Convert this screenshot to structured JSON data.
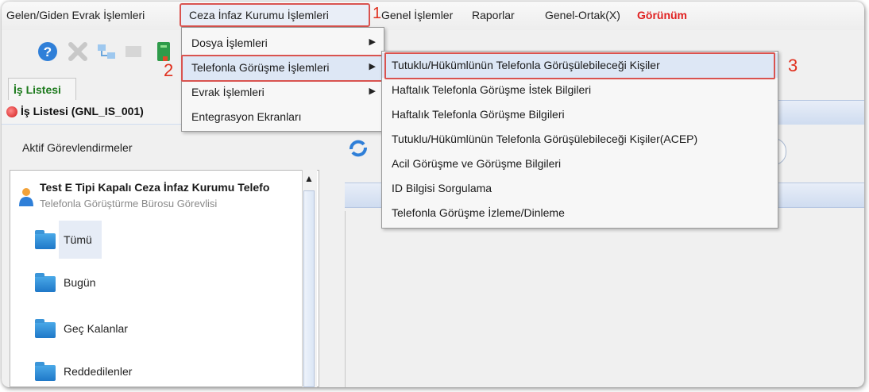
{
  "menubar": {
    "items": [
      "Gelen/Giden Evrak İşlemleri",
      "Ceza İnfaz Kurumu İşlemleri",
      "Genel İşlemler",
      "Raporlar",
      "Genel-Ortak(X)",
      "Görünüm"
    ],
    "step1": "1",
    "active_color": "#e02020"
  },
  "annotations": {
    "step2": "2",
    "step3": "3",
    "color": "#d9534f"
  },
  "toolbar": {
    "icons": [
      "help-icon",
      "delete-icon",
      "network-icon",
      "screen-icon",
      "book-icon"
    ]
  },
  "tabs": {
    "is_listesi": "İş Listesi"
  },
  "strip": {
    "title": "İş Listesi (GNL_IS_001)"
  },
  "left": {
    "heading": "Aktif Görevlendirmeler",
    "tree_title": "Test E Tipi Kapalı Ceza İnfaz Kurumu Telefo",
    "tree_subtitle": "Telefonla Görüştürme Bürosu Görevlisi",
    "items": [
      "Tümü",
      "Bugün",
      "Geç Kalanlar",
      "Reddedilenler"
    ]
  },
  "dropdown1": {
    "items": [
      "Dosya İşlemleri",
      "Telefonla Görüşme İşlemleri",
      "Evrak İşlemleri",
      "Entegrasyon Ekranları"
    ]
  },
  "dropdown2": {
    "items": [
      "Tutuklu/Hükümlünün Telefonla Görüşülebileceği Kişiler",
      "Haftalık Telefonla Görüşme İstek Bilgileri",
      "Haftalık Telefonla Görüşme Bilgileri",
      "Tutuklu/Hükümlünün Telefonla Görüşülebileceği Kişiler(ACEP)",
      "Acil Görüşme ve Görüşme Bilgileri",
      "ID Bilgisi Sorgulama",
      "Telefonla Görüşme İzleme/Dinleme"
    ]
  }
}
